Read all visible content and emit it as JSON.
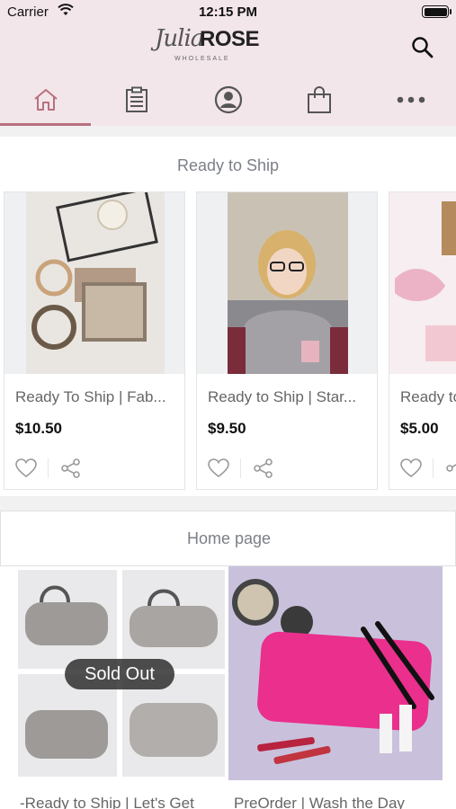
{
  "status_bar": {
    "carrier": "Carrier",
    "time": "12:15 PM"
  },
  "header": {
    "logo_script": "Julia",
    "logo_brand": "ROSE",
    "logo_sub": "WHOLESALE",
    "tabs": [
      {
        "icon": "home-icon",
        "active": true
      },
      {
        "icon": "clipboard-icon",
        "active": false
      },
      {
        "icon": "account-icon",
        "active": false
      },
      {
        "icon": "shopping-bag-icon",
        "active": false
      },
      {
        "icon": "more-icon",
        "active": false
      }
    ]
  },
  "sections": {
    "ready_to_ship": {
      "title": "Ready to Ship",
      "products": [
        {
          "name": "Ready To Ship | Fab...",
          "price": "$10.50"
        },
        {
          "name": "Ready to Ship | Star...",
          "price": "$9.50"
        },
        {
          "name": "Ready to",
          "price": "$5.00"
        }
      ]
    },
    "home_page": {
      "title": "Home page",
      "items": [
        {
          "name": "-Ready to Ship | Let's Get",
          "badge": "Sold Out"
        },
        {
          "name": "PreOrder | Wash the Day"
        }
      ]
    }
  },
  "colors": {
    "accent": "#b9707f",
    "header_bg": "#f3e6ea"
  }
}
